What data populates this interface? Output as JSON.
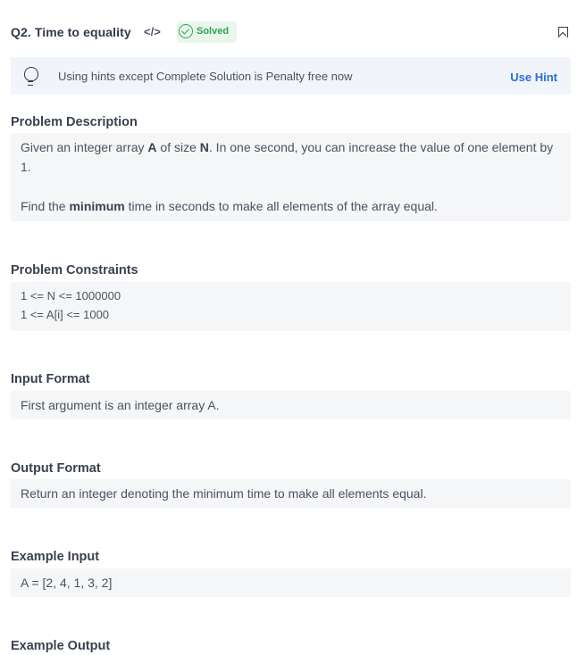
{
  "header": {
    "title": "Q2. Time to equality",
    "code_icon": "</>",
    "status_badge": "Solved",
    "icons": {
      "code": "code-icon",
      "solved": "check-circle-icon",
      "bookmark": "bookmark-icon"
    }
  },
  "hint_bar": {
    "icon": "lightbulb-icon",
    "text": "Using hints except Complete Solution is Penalty free now",
    "button": "Use Hint"
  },
  "sections": {
    "description": {
      "heading": "Problem Description",
      "p1_a": "Given an integer array ",
      "p1_b": "A",
      "p1_c": " of size ",
      "p1_d": "N",
      "p1_e": ". In one second, you can increase the value of one element by 1.",
      "p2_a": "Find the ",
      "p2_b": "minimum",
      "p2_c": " time in seconds to make all elements of the array equal."
    },
    "constraints": {
      "heading": "Problem Constraints",
      "line1": "1 <= N <= 1000000",
      "line2": "1 <= A[i] <= 1000"
    },
    "input_format": {
      "heading": "Input Format",
      "text": "First argument is an integer array A."
    },
    "output_format": {
      "heading": "Output Format",
      "text": "Return an integer denoting the minimum time to make all elements equal."
    },
    "example_input": {
      "heading": "Example Input",
      "text": "A = [2, 4, 1, 3, 2]"
    },
    "example_output": {
      "heading": "Example Output"
    }
  }
}
